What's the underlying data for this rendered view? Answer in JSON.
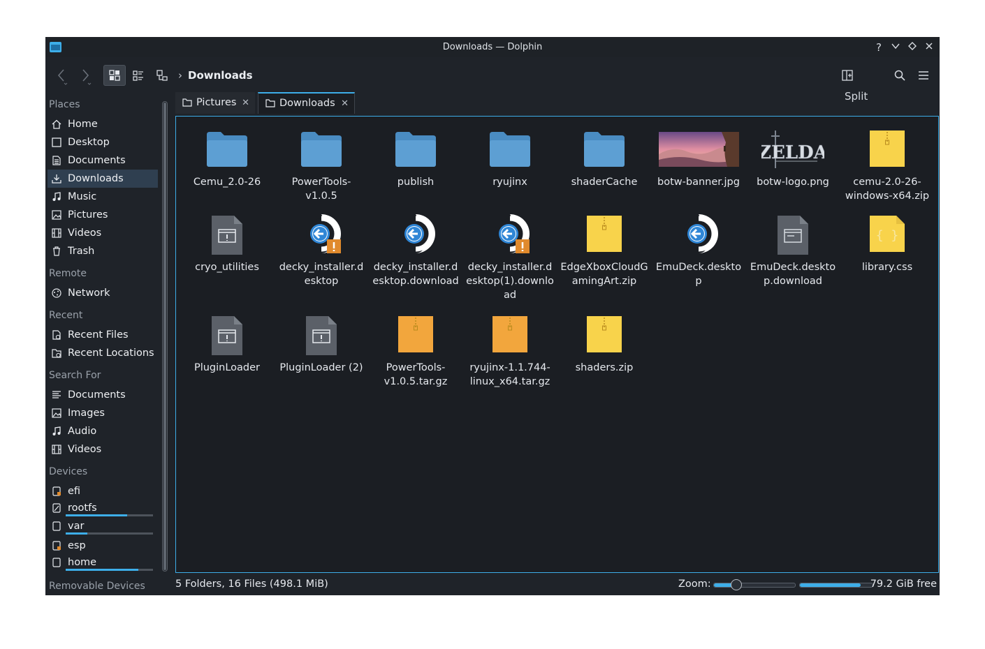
{
  "window": {
    "title": "Downloads — Dolphin"
  },
  "titlebar_buttons": [
    "?",
    "⌵",
    "◇",
    "✕"
  ],
  "toolbar": {
    "breadcrumb": "Downloads",
    "split_label": "Split"
  },
  "sidebar": {
    "sections": [
      {
        "title": "Places",
        "items": [
          {
            "label": "Home",
            "icon": "home-icon"
          },
          {
            "label": "Desktop",
            "icon": "desktop-icon"
          },
          {
            "label": "Documents",
            "icon": "documents-icon"
          },
          {
            "label": "Downloads",
            "icon": "downloads-icon",
            "selected": true
          },
          {
            "label": "Music",
            "icon": "music-icon"
          },
          {
            "label": "Pictures",
            "icon": "pictures-icon"
          },
          {
            "label": "Videos",
            "icon": "videos-icon"
          },
          {
            "label": "Trash",
            "icon": "trash-icon"
          }
        ]
      },
      {
        "title": "Remote",
        "items": [
          {
            "label": "Network",
            "icon": "network-icon"
          }
        ]
      },
      {
        "title": "Recent",
        "items": [
          {
            "label": "Recent Files",
            "icon": "recent-files-icon"
          },
          {
            "label": "Recent Locations",
            "icon": "recent-locations-icon"
          }
        ]
      },
      {
        "title": "Search For",
        "items": [
          {
            "label": "Documents",
            "icon": "documents-icon"
          },
          {
            "label": "Images",
            "icon": "images-icon"
          },
          {
            "label": "Audio",
            "icon": "audio-icon"
          },
          {
            "label": "Videos",
            "icon": "videos-icon"
          }
        ]
      },
      {
        "title": "Devices",
        "items": [
          {
            "label": "efi",
            "icon": "drive-icon"
          },
          {
            "label": "rootfs",
            "icon": "drive-icon",
            "usage": 0.7
          },
          {
            "label": "var",
            "icon": "drive-icon",
            "usage": 0.25
          },
          {
            "label": "esp",
            "icon": "drive-icon"
          },
          {
            "label": "home",
            "icon": "drive-icon",
            "usage": 0.83
          }
        ]
      },
      {
        "title": "Removable Devices",
        "items": []
      }
    ]
  },
  "tabs": [
    {
      "label": "Pictures",
      "active": false
    },
    {
      "label": "Downloads",
      "active": true
    }
  ],
  "files": [
    {
      "name": "Cemu_2.0-26",
      "type": "folder"
    },
    {
      "name": "PowerTools-v1.0.5",
      "type": "folder"
    },
    {
      "name": "publish",
      "type": "folder"
    },
    {
      "name": "ryujinx",
      "type": "folder"
    },
    {
      "name": "shaderCache",
      "type": "folder"
    },
    {
      "name": "botw-banner.jpg",
      "type": "image"
    },
    {
      "name": "botw-logo.png",
      "type": "logo-image",
      "logo_text": "ZELDA"
    },
    {
      "name": "cemu-2.0-26-windows-x64.zip",
      "type": "zip"
    },
    {
      "name": "cryo_utilities",
      "type": "executable"
    },
    {
      "name": "decky_installer.desktop",
      "type": "desktop-warn"
    },
    {
      "name": "decky_installer.desktop.download",
      "type": "desktop"
    },
    {
      "name": "decky_installer.desktop(1).download",
      "type": "desktop-warn"
    },
    {
      "name": "EdgeXboxCloudGamingArt.zip",
      "type": "zip"
    },
    {
      "name": "EmuDeck.desktop",
      "type": "desktop"
    },
    {
      "name": "EmuDeck.desktop.download",
      "type": "generic"
    },
    {
      "name": "library.css",
      "type": "css"
    },
    {
      "name": "PluginLoader",
      "type": "executable"
    },
    {
      "name": "PluginLoader (2)",
      "type": "executable"
    },
    {
      "name": "PowerTools-v1.0.5.tar.gz",
      "type": "tar"
    },
    {
      "name": "ryujinx-1.1.744-linux_x64.tar.gz",
      "type": "tar"
    },
    {
      "name": "shaders.zip",
      "type": "zip"
    }
  ],
  "status": {
    "summary": "5 Folders, 16 Files (498.1 MiB)",
    "zoom_label": "Zoom:",
    "zoom_level": 0.28,
    "disk_used_fraction": 0.84,
    "free_space": "79.2 GiB free"
  },
  "colors": {
    "accent": "#3daee9",
    "folder": "#5d9fd3",
    "zip": "#f8d34b",
    "tar": "#f2a63d"
  }
}
